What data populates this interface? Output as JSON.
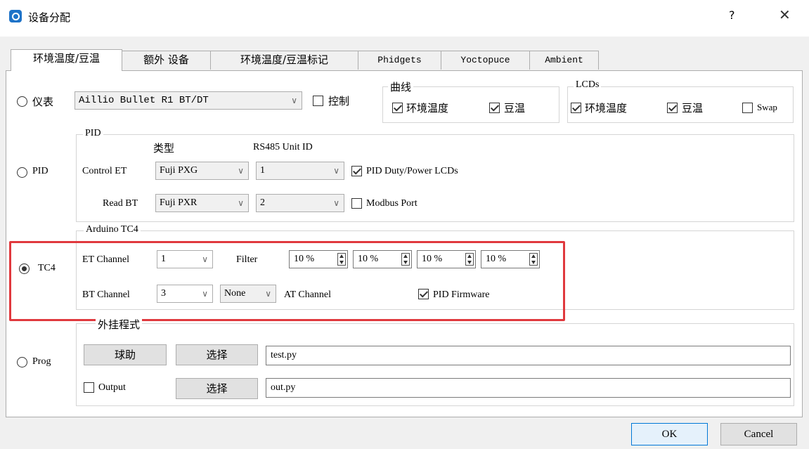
{
  "window": {
    "title": "设备分配",
    "help": "?",
    "close": "✕"
  },
  "tabs": [
    {
      "label": "环境温度/豆温"
    },
    {
      "label": "额外 设备"
    },
    {
      "label": "环境温度/豆温标记"
    },
    {
      "label": "Phidgets"
    },
    {
      "label": "Yoctopuce"
    },
    {
      "label": "Ambient"
    }
  ],
  "meter": {
    "radio_label": "仪表",
    "device": "Aillio Bullet R1 BT/DT",
    "control_label": "控制"
  },
  "curves": {
    "title": "曲线",
    "et": "环境温度",
    "bt": "豆温"
  },
  "lcds": {
    "title": "LCDs",
    "et": "环境温度",
    "bt": "豆温",
    "swap": "Swap"
  },
  "pid": {
    "radio_label": "PID",
    "group_title": "PID",
    "type_header": "类型",
    "unit_header": "RS485 Unit ID",
    "control_label": "Control ET",
    "read_label": "Read BT",
    "control_type": "Fuji PXG",
    "read_type": "Fuji PXR",
    "control_unit": "1",
    "read_unit": "2",
    "duty_lcd": "PID Duty/Power LCDs",
    "modbus": "Modbus Port"
  },
  "tc4": {
    "radio_label": "TC4",
    "group_title": "Arduino TC4",
    "et_channel_label": "ET Channel",
    "et_channel": "1",
    "bt_channel_label": "BT Channel",
    "bt_channel": "3",
    "filter_label": "Filter",
    "filters": [
      "10 %",
      "10 %",
      "10 %",
      "10 %"
    ],
    "at_value": "None",
    "at_label": "AT Channel",
    "firmware": "PID Firmware",
    "highlight_color": "#e0393e"
  },
  "prog": {
    "radio_label": "Prog",
    "group_title": "外挂程式",
    "assist_button": "球助",
    "select_button_1": "选择",
    "input_file": "test.py",
    "output_label": "Output",
    "select_button_2": "选择",
    "output_file": "out.py"
  },
  "footer": {
    "ok": "OK",
    "cancel": "Cancel"
  }
}
